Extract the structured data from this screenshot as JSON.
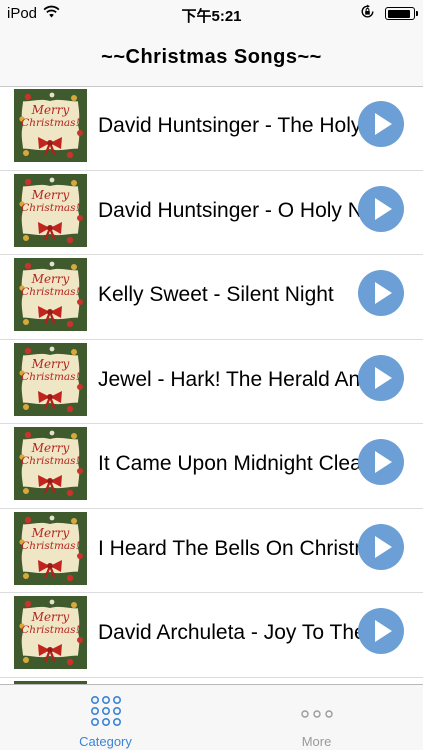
{
  "status_bar": {
    "carrier": "iPod",
    "time": "下午5:21",
    "battery_level": 0.9
  },
  "nav": {
    "title": "~~Christmas Songs~~"
  },
  "thumbnail": {
    "line1": "Merry",
    "line2": "Christmas!"
  },
  "songs": [
    {
      "title": "David Huntsinger - The Holy Night"
    },
    {
      "title": "David Huntsinger - O Holy Night"
    },
    {
      "title": "Kelly Sweet - Silent Night"
    },
    {
      "title": "Jewel - Hark! The Herald Angels Sing"
    },
    {
      "title": "It Came Upon Midnight Clear"
    },
    {
      "title": "I Heard The Bells On Christmas Day"
    },
    {
      "title": "David Archuleta - Joy To The World"
    },
    {
      "title": ""
    }
  ],
  "tab_bar": {
    "tabs": [
      {
        "label": "Category",
        "active": true
      },
      {
        "label": "More",
        "active": false
      }
    ]
  },
  "colors": {
    "accent": "#3a84d8",
    "play_button": "#6c9fd6",
    "inactive_tab": "#9a9a9a"
  }
}
